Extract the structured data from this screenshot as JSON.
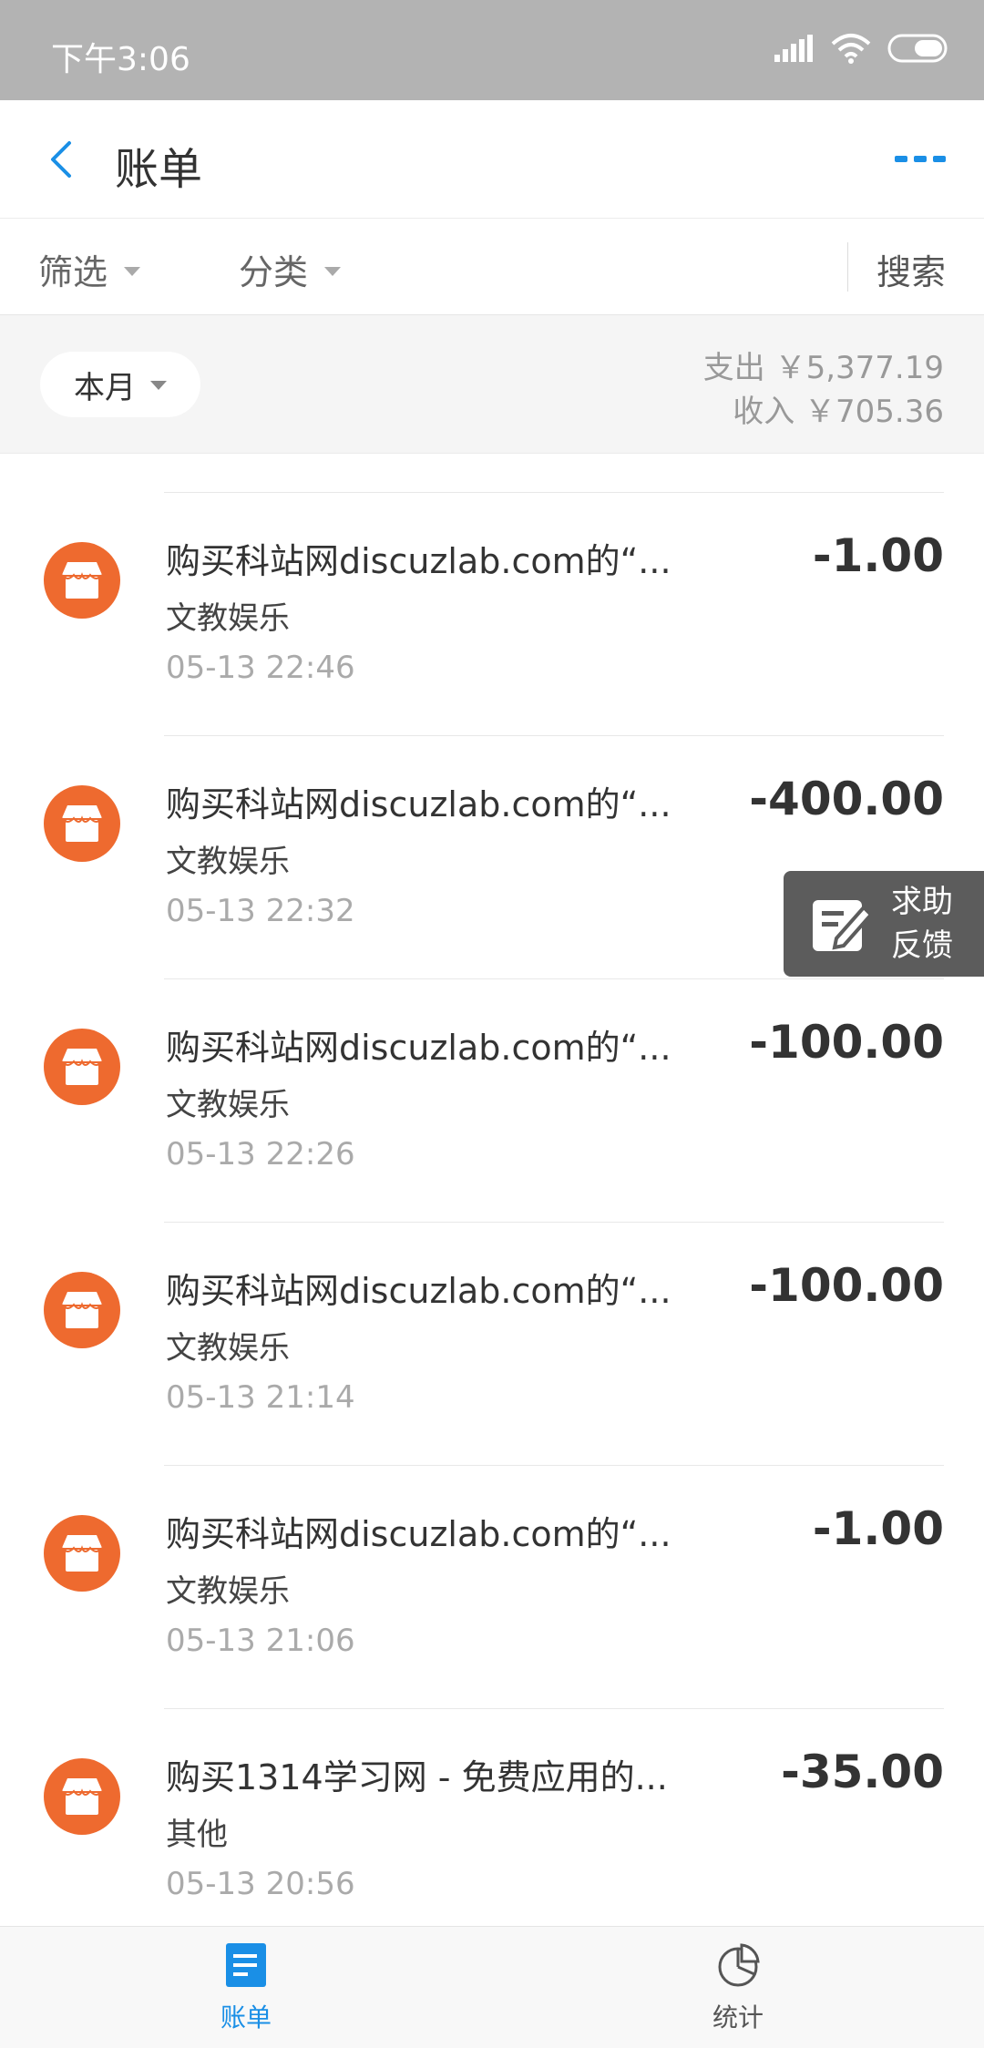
{
  "status_bar": {
    "time": "下午3:06"
  },
  "header": {
    "title": "账单"
  },
  "filters": {
    "filter_label": "筛选",
    "category_label": "分类",
    "search_label": "搜索"
  },
  "summary": {
    "month_label": "本月",
    "expense": "支出 ￥5,377.19",
    "income": "收入 ￥705.36"
  },
  "transactions": [
    {
      "name": "购买科站网discuzlab.com的“...",
      "category": "文教娱乐",
      "time": "05-13  22:46",
      "amount": "-1.00"
    },
    {
      "name": "购买科站网discuzlab.com的“...",
      "category": "文教娱乐",
      "time": "05-13  22:32",
      "amount": "-400.00"
    },
    {
      "name": "购买科站网discuzlab.com的“...",
      "category": "文教娱乐",
      "time": "05-13  22:26",
      "amount": "-100.00"
    },
    {
      "name": "购买科站网discuzlab.com的“...",
      "category": "文教娱乐",
      "time": "05-13  21:14",
      "amount": "-100.00"
    },
    {
      "name": "购买科站网discuzlab.com的“...",
      "category": "文教娱乐",
      "time": "05-13  21:06",
      "amount": "-1.00"
    },
    {
      "name": "购买1314学习网 - 免费应用的...",
      "category": "其他",
      "time": "05-13  20:56",
      "amount": "-35.00"
    }
  ],
  "help_button": {
    "line1": "求助",
    "line2": "反馈"
  },
  "bottom_nav": {
    "bills_label": "账单",
    "stats_label": "统计"
  },
  "colors": {
    "accent": "#1a8fe6",
    "icon_orange": "#ee6a2f",
    "status_bar": "#b3b3b3"
  },
  "icons": [
    "back-arrow-icon",
    "more-icon",
    "store-icon",
    "feedback-edit-icon",
    "bill-list-icon",
    "pie-chart-icon",
    "signal-icon",
    "wifi-icon",
    "battery-icon"
  ]
}
